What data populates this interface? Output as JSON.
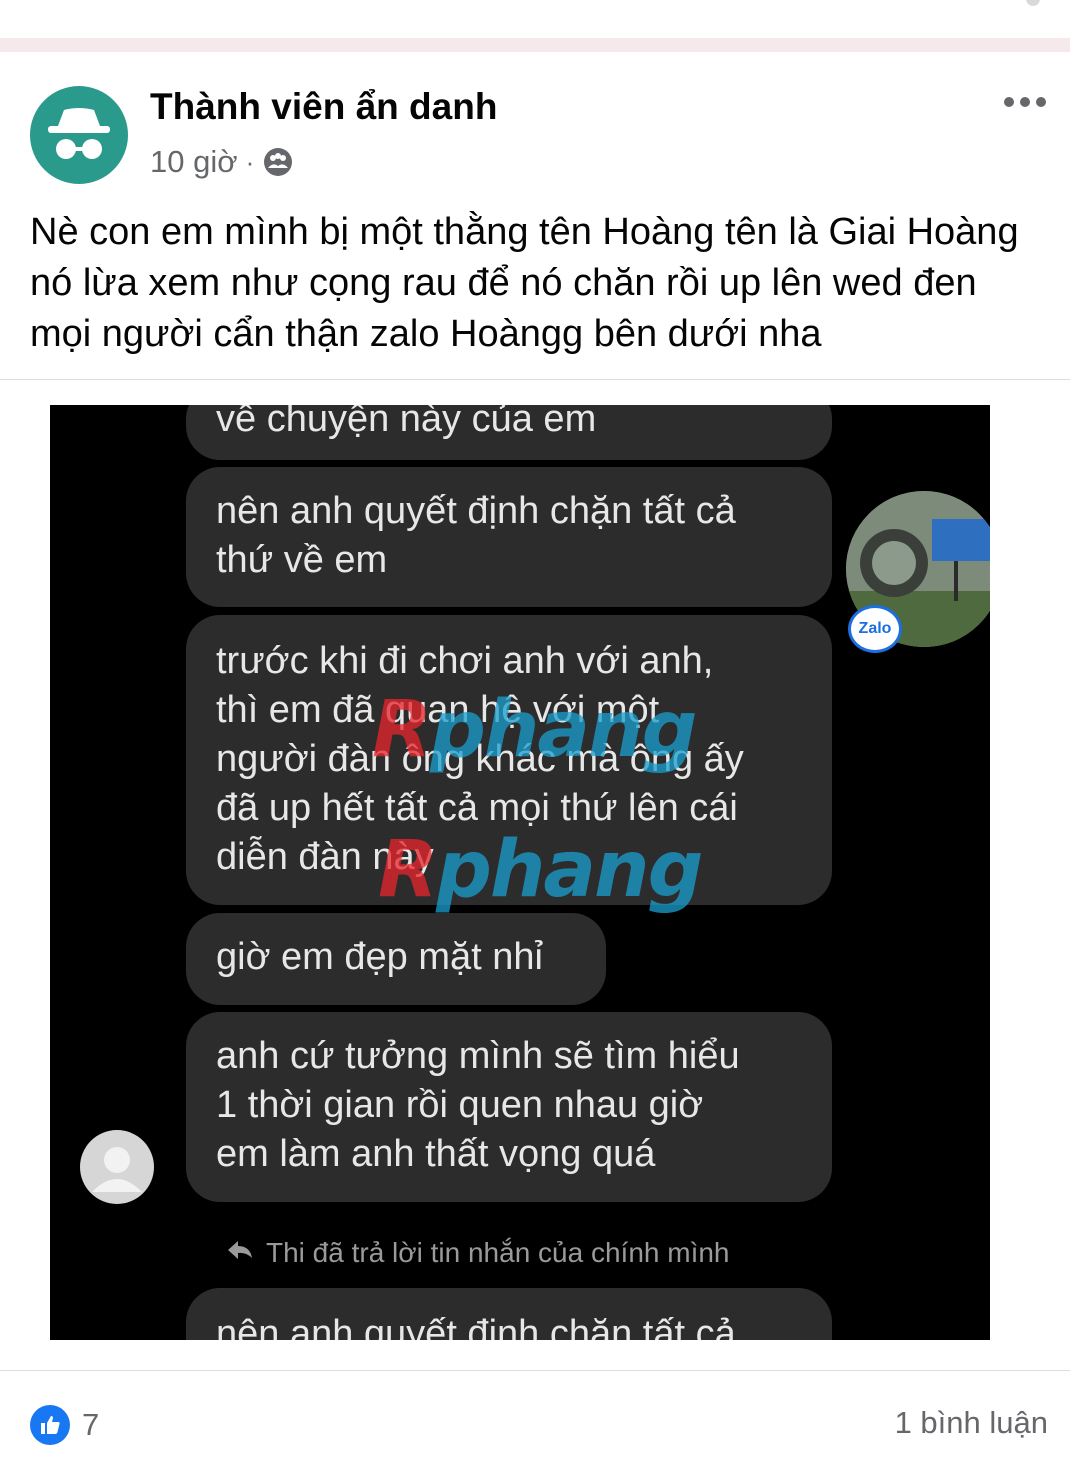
{
  "post": {
    "author": "Thành viên ẩn danh",
    "time": "10 giờ",
    "separator": "·",
    "audience_icon": "group-audience-icon",
    "avatar_icon": "anonymous-incognito-icon",
    "more_icon": "more-horizontal-icon",
    "text": "Nè con em mình bị một thằng tên Hoàng tên là Giai Hoàng nó lừa xem như cọng rau để nó chăn rồi up lên wed đen mọi người cẩn thận zalo Hoàngg bên dưới nha"
  },
  "screenshot": {
    "messages": [
      "về chuyện này của em",
      "nên anh quyết định chặn tất cả\nthứ về em",
      "trước khi đi chơi anh với anh,\nthì em đã quan hệ với một\nngười đàn ông khác mà ông ấy\nđã up hết tất cả mọi thứ lên cái\ndiễn đàn này",
      "giờ em đẹp mặt nhỉ",
      "anh cứ tưởng mình sẽ tìm hiểu\n1 thời gian rồi quen nhau giờ\nem làm anh thất vọng quá",
      "nên anh quyết định chặn tất cả"
    ],
    "reply_note": "Thi đã trả lời tin nhắn của chính mình",
    "watermark_red": "R",
    "watermark_blue": "phang",
    "zalo_badge": "Zalo"
  },
  "footer": {
    "like_count": "7",
    "comments": "1 bình luận"
  },
  "colors": {
    "like_blue": "#1877f2",
    "avatar_teal": "#2a9a8c",
    "bubble": "#2c2c2c",
    "secondary_text": "#65676b"
  }
}
